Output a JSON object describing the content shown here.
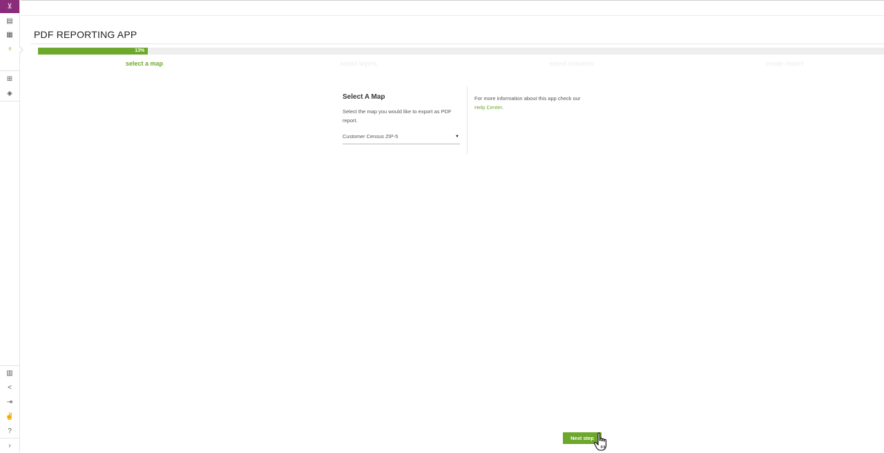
{
  "app": {
    "title": "PDF REPORTING APP"
  },
  "sidebar": {
    "top_items": [
      {
        "name": "cart-icon",
        "glyph": "⊻"
      },
      {
        "name": "layers-doc-icon",
        "glyph": "▤"
      },
      {
        "name": "chart-icon",
        "glyph": "▦"
      },
      {
        "name": "apps-grid-icon",
        "glyph": "⁝⁝⁝"
      }
    ],
    "mid_items": [
      {
        "name": "add-icon",
        "glyph": "⊞"
      },
      {
        "name": "layers-icon",
        "glyph": "◈"
      }
    ],
    "bottom_items": [
      {
        "name": "map-icon",
        "glyph": "▥"
      },
      {
        "name": "share-icon",
        "glyph": "<"
      },
      {
        "name": "signin-icon",
        "glyph": "⇥"
      },
      {
        "name": "thumbs-up-icon",
        "glyph": "✌"
      },
      {
        "name": "help-icon",
        "glyph": "?"
      },
      {
        "name": "expand-icon",
        "glyph": "›"
      }
    ]
  },
  "progress": {
    "percent": 13,
    "label": "13%"
  },
  "steps": [
    {
      "label": "select a map",
      "state": "current"
    },
    {
      "label": "select layers",
      "state": "upcoming"
    },
    {
      "label": "select columns",
      "state": "upcoming"
    },
    {
      "label": "create report",
      "state": "upcoming"
    }
  ],
  "select_map": {
    "title": "Select A Map",
    "description": "Select the map you would like to export as PDF report.",
    "selected": "Customer Census ZIP-5",
    "caret": "▼"
  },
  "info": {
    "text": "For more information about this app check our",
    "link": "Help Center",
    "suffix": "."
  },
  "actions": {
    "next_label": "Next step"
  },
  "colors": {
    "accent": "#6da72b",
    "brand": "#8b2c7a"
  }
}
